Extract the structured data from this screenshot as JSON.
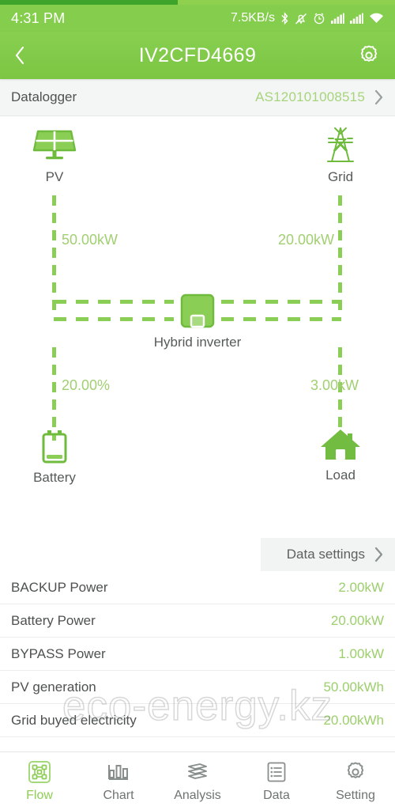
{
  "status_bar": {
    "time": "4:31 PM",
    "network_speed": "7.5KB/s",
    "icons": [
      "bluetooth-icon",
      "mute-bell-icon",
      "alarm-icon",
      "signal-bars-icon",
      "signal-bars-icon",
      "wifi-icon"
    ]
  },
  "app_bar": {
    "back_icon": "chevron-left-icon",
    "title": "IV2CFD4669",
    "settings_icon": "gear-icon"
  },
  "datalogger": {
    "label": "Datalogger",
    "value": "AS120101008515",
    "chevron_icon": "chevron-right-icon"
  },
  "flow": {
    "pv": {
      "label": "PV",
      "value": "50.00kW",
      "icon": "solar-panel-icon"
    },
    "grid": {
      "label": "Grid",
      "value": "20.00kW",
      "icon": "power-tower-icon"
    },
    "inverter": {
      "label": "Hybrid inverter",
      "icon": "inverter-icon"
    },
    "battery": {
      "label": "Battery",
      "value": "20.00%",
      "icon": "battery-icon"
    },
    "load": {
      "label": "Load",
      "value": "3.00kW",
      "icon": "house-icon"
    }
  },
  "data_settings": {
    "label": "Data settings",
    "chevron_icon": "chevron-right-icon"
  },
  "metrics": [
    {
      "label": "BACKUP Power",
      "value": "2.00kW"
    },
    {
      "label": "Battery Power",
      "value": "20.00kW"
    },
    {
      "label": "BYPASS Power",
      "value": "1.00kW"
    },
    {
      "label": "PV generation",
      "value": "50.00kWh"
    },
    {
      "label": "Grid buyed electricity",
      "value": "20.00kWh"
    }
  ],
  "watermark": {
    "text": "eco-energy.kz"
  },
  "tabbar": {
    "items": [
      {
        "label": "Flow",
        "icon": "flow-diagram-icon",
        "active": true
      },
      {
        "label": "Chart",
        "icon": "bar-chart-icon",
        "active": false
      },
      {
        "label": "Analysis",
        "icon": "layers-icon",
        "active": false
      },
      {
        "label": "Data",
        "icon": "list-document-icon",
        "active": false
      },
      {
        "label": "Setting",
        "icon": "gear-icon",
        "active": false
      }
    ]
  },
  "colors": {
    "brand_green": "#7cc643",
    "accent_green": "#8bce55",
    "value_green": "#9ccf6c",
    "text_dark": "#4d5250"
  }
}
